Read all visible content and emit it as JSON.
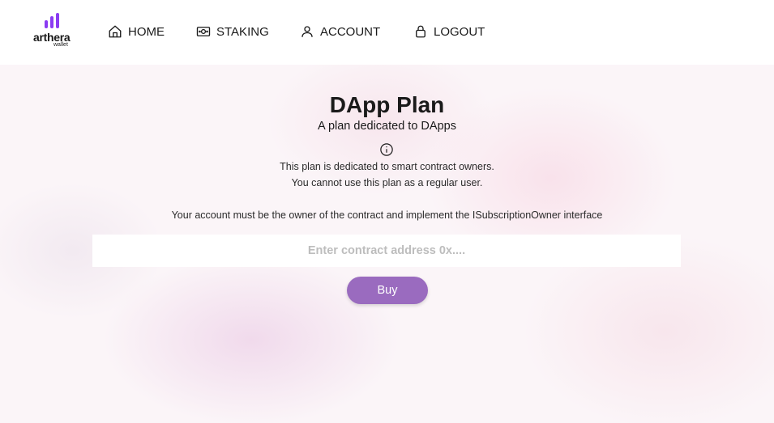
{
  "brand": {
    "name": "arthera",
    "sub": "wallet",
    "color": "#8b3cf2"
  },
  "nav": {
    "home": {
      "label": "HOME",
      "icon": "home-icon"
    },
    "staking": {
      "label": "STAKING",
      "icon": "banknote-icon"
    },
    "account": {
      "label": "ACCOUNT",
      "icon": "user-icon"
    },
    "logout": {
      "label": "LOGOUT",
      "icon": "lock-icon"
    }
  },
  "plan": {
    "title": "DApp Plan",
    "subtitle": "A plan dedicated to DApps",
    "info_icon": "info-icon",
    "info_line_1": "This plan is dedicated to smart contract owners.",
    "info_line_2": "You cannot use this plan as a regular user.",
    "owner_note": "Your account must be the owner of the contract and implement the ISubscriptionOwner interface",
    "address_input": {
      "value": "",
      "placeholder": "Enter contract address 0x...."
    },
    "buy_label": "Buy",
    "buy_color": "#9a6bbf"
  }
}
